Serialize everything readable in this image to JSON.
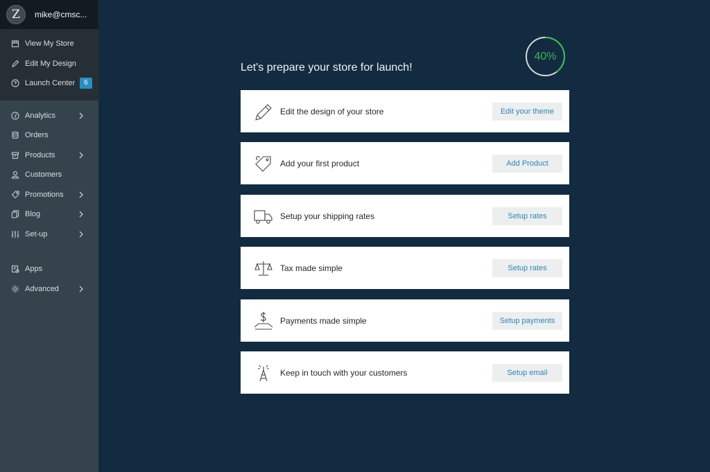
{
  "user": {
    "avatar_letter": "Z",
    "name": "mike@cmsc..."
  },
  "top_menu": [
    {
      "label": "View My Store",
      "icon": "store-icon"
    },
    {
      "label": "Edit My Design",
      "icon": "pencil-icon"
    },
    {
      "label": "Launch Center",
      "icon": "help-circle-icon",
      "badge": "6"
    }
  ],
  "main_menu": [
    {
      "label": "Analytics",
      "icon": "analytics-icon",
      "has_submenu": true
    },
    {
      "label": "Orders",
      "icon": "database-icon",
      "has_submenu": false
    },
    {
      "label": "Products",
      "icon": "box-icon",
      "has_submenu": true
    },
    {
      "label": "Customers",
      "icon": "user-icon",
      "has_submenu": false
    },
    {
      "label": "Promotions",
      "icon": "tag-icon",
      "has_submenu": true
    },
    {
      "label": "Blog",
      "icon": "copy-icon",
      "has_submenu": true
    },
    {
      "label": "Set-up",
      "icon": "sliders-icon",
      "has_submenu": true
    }
  ],
  "bottom_menu": [
    {
      "label": "Apps",
      "icon": "apps-icon",
      "has_submenu": false
    },
    {
      "label": "Advanced",
      "icon": "gear-icon",
      "has_submenu": true
    }
  ],
  "content": {
    "heading": "Let's prepare your store for launch!",
    "progress_label": "40%",
    "progress_fraction": 0.4,
    "progress_color": "#3cb55a",
    "tasks": [
      {
        "label": "Edit the design of your store",
        "button": "Edit your theme",
        "icon": "pencil-icon"
      },
      {
        "label": "Add your first product",
        "button": "Add Product",
        "icon": "price-tag-icon"
      },
      {
        "label": "Setup your shipping rates",
        "button": "Setup rates",
        "icon": "truck-icon"
      },
      {
        "label": "Tax made simple",
        "button": "Setup rates",
        "icon": "scales-icon"
      },
      {
        "label": "Payments made simple",
        "button": "Setup payments",
        "icon": "dollar-hand-icon"
      },
      {
        "label": "Keep in touch with your customers",
        "button": "Setup email",
        "icon": "antenna-icon"
      }
    ]
  }
}
